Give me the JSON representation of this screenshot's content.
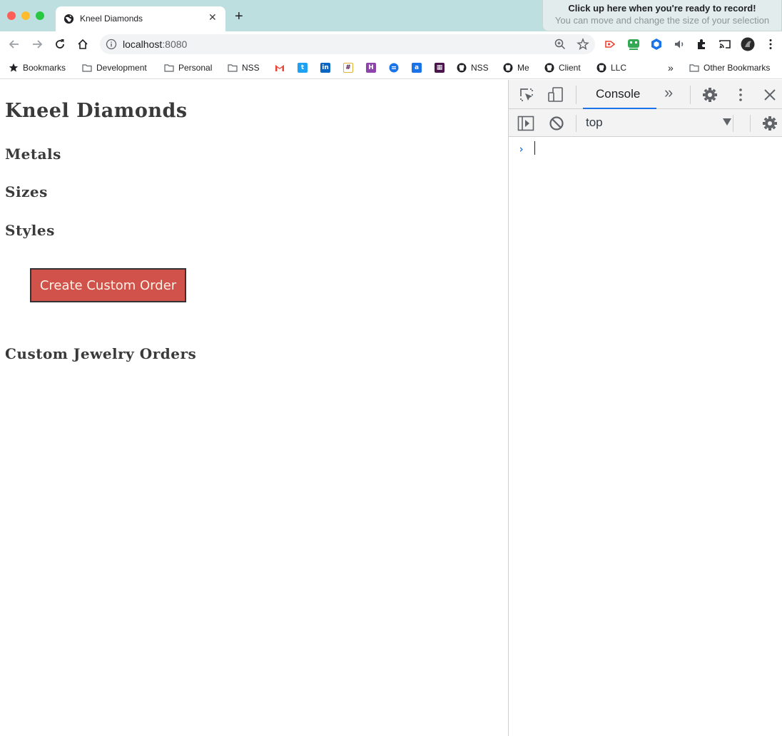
{
  "browser": {
    "tab_title": "Kneel Diamonds",
    "tab_close": "✕",
    "new_tab": "+",
    "url_host": "localhost",
    "url_port": ":8080",
    "recorder": {
      "line1": "Click up here when you're ready to record!",
      "line2": "You can move and change the size of your selection"
    },
    "bookmarks": [
      {
        "label": "Bookmarks",
        "icon": "star-icon"
      },
      {
        "label": "Development",
        "icon": "folder-icon"
      },
      {
        "label": "Personal",
        "icon": "folder-icon"
      },
      {
        "label": "NSS",
        "icon": "folder-icon"
      },
      {
        "label": "",
        "icon": "gmail-icon"
      },
      {
        "label": "",
        "icon": "twitter-icon"
      },
      {
        "label": "",
        "icon": "linkedin-icon"
      },
      {
        "label": "",
        "icon": "slack-icon"
      },
      {
        "label": "",
        "icon": "h-icon"
      },
      {
        "label": "",
        "icon": "chat-icon"
      },
      {
        "label": "",
        "icon": "amazon-icon"
      },
      {
        "label": "",
        "icon": "trello-icon"
      },
      {
        "label": "NSS",
        "icon": "github-icon"
      },
      {
        "label": "Me",
        "icon": "github-icon"
      },
      {
        "label": "Client",
        "icon": "github-icon"
      },
      {
        "label": "LLC",
        "icon": "github-icon"
      }
    ],
    "more_bookmarks": "»",
    "other_bookmarks": "Other Bookmarks"
  },
  "page": {
    "title": "Kneel Diamonds",
    "metals_heading": "Metals",
    "sizes_heading": "Sizes",
    "styles_heading": "Styles",
    "order_button": "Create Custom Order",
    "orders_heading": "Custom Jewelry Orders",
    "button_color": "#d0524a"
  },
  "devtools": {
    "active_tab": "Console",
    "more_tabs": "»",
    "context": "top",
    "prompt": "›",
    "accent": "#1a73e8"
  }
}
